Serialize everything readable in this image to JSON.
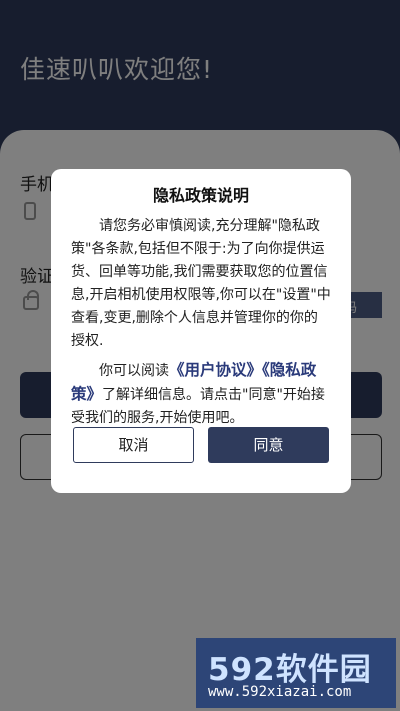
{
  "header": {
    "welcome": "佳速叭叭欢迎您!"
  },
  "form": {
    "phone_label": "手机",
    "code_label": "验证",
    "code_button": "码"
  },
  "dialog": {
    "title": "隐私政策说明",
    "body": "请您务必审慎阅读,充分理解\"隐私政策\"各条款,包括但不限于:为了向你提供运货、回单等功能,我们需要获取您的位置信息,开启相机使用权限等,你可以在\"设置\"中查看,变更,删除个人信息并管理你的你的授权.",
    "body2_prefix": "你可以阅读",
    "user_agreement_link": "《用户协议》",
    "privacy_link": "《隐私政策》",
    "body2_suffix": "了解详细信息。请点击\"同意\"开始接受我们的服务,开始使用吧。",
    "cancel_label": "取消",
    "agree_label": "同意"
  },
  "watermark": {
    "top": "592软件园",
    "bottom": "www.592xiazai.com"
  },
  "colors": {
    "primary": "#2f3b5c",
    "watermark_bg": "#2d4577"
  }
}
